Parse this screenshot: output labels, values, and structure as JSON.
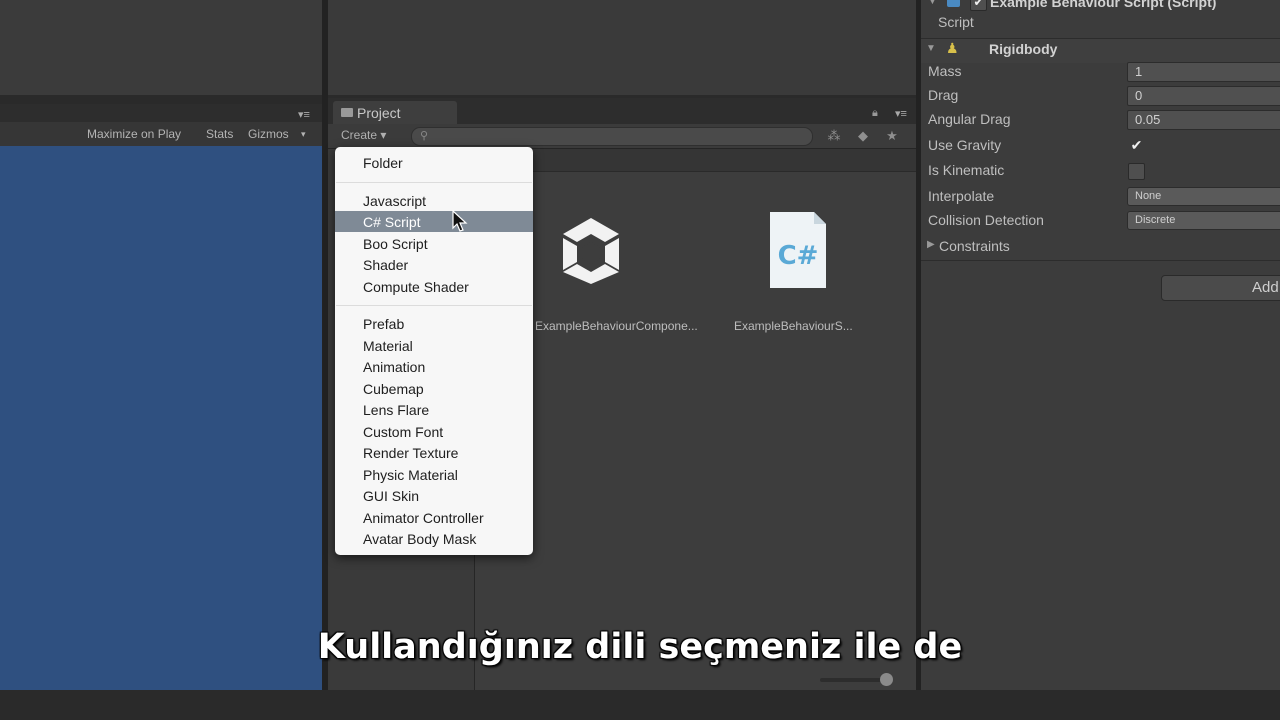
{
  "game_toolbar": {
    "maximize_on_play": "Maximize on Play",
    "stats": "Stats",
    "gizmos": "Gizmos",
    "menu_glyph": "▾≡"
  },
  "project": {
    "tab_label": "Project",
    "create_label": "Create ▾",
    "assets": [
      {
        "label": "ExampleBehaviourCompone...",
        "icon": "unity-logo-icon"
      },
      {
        "label": "ExampleBehaviourS...",
        "icon": "csharp-file-icon"
      }
    ],
    "csharp_icon_text": "C#"
  },
  "create_menu": {
    "groups": [
      [
        "Folder"
      ],
      [
        "Javascript",
        "C# Script",
        "Boo Script",
        "Shader",
        "Compute Shader"
      ],
      [
        "Prefab",
        "Material",
        "Animation",
        "Cubemap",
        "Lens Flare",
        "Custom Font",
        "Render Texture",
        "Physic Material",
        "GUI Skin",
        "Animator Controller",
        "Avatar Body Mask"
      ]
    ],
    "selected": "C# Script"
  },
  "inspector": {
    "script_component_title": "Example Behaviour Script (Script)",
    "script_field_label": "Script",
    "rigidbody_title": "Rigidbody",
    "rows": {
      "mass": {
        "label": "Mass",
        "value": "1"
      },
      "drag": {
        "label": "Drag",
        "value": "0"
      },
      "angular_drag": {
        "label": "Angular Drag",
        "value": "0.05"
      },
      "use_gravity": {
        "label": "Use Gravity",
        "checked": true,
        "glyph": "✔"
      },
      "is_kinematic": {
        "label": "Is Kinematic",
        "checked": false
      },
      "interpolate": {
        "label": "Interpolate",
        "value": "None"
      },
      "collision_detection": {
        "label": "Collision Detection",
        "value": "Discrete"
      },
      "constraints": {
        "label": "Constraints"
      }
    },
    "add_button_label": "Add"
  },
  "subtitle": "Kullandığınız dili seçmeniz ile de",
  "colors": {
    "game_view_blue": "#2f5080",
    "menu_selection": "#7f8a96",
    "csharp_icon": "#5aa9d6"
  }
}
